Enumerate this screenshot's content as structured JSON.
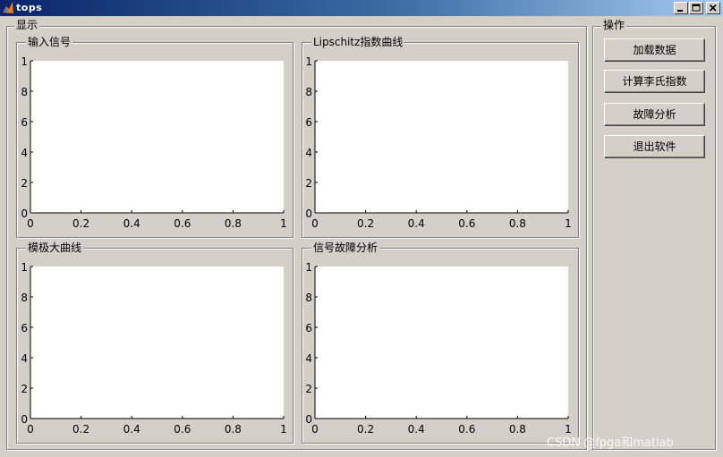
{
  "window": {
    "title": "tops",
    "controls": {
      "minimize": "_",
      "maximize": "□",
      "close": "×"
    }
  },
  "display_panel": {
    "title": "显示"
  },
  "operations_panel": {
    "title": "操作"
  },
  "plots": [
    {
      "id": "input-signal",
      "title": "输入信号"
    },
    {
      "id": "lipschitz-curve",
      "title": "Lipschitz指数曲线"
    },
    {
      "id": "modulus-max-curve",
      "title": "模极大曲线"
    },
    {
      "id": "signal-fault-analysis",
      "title": "信号故障分析"
    }
  ],
  "axes_ticks": {
    "x": [
      "0",
      "0.2",
      "0.4",
      "0.6",
      "0.8",
      "1"
    ],
    "y": [
      "0",
      "2",
      "4",
      "6",
      "8",
      "1"
    ]
  },
  "buttons": [
    {
      "id": "load-data",
      "label": "加载数据"
    },
    {
      "id": "compute-lipschitz",
      "label": "计算李氏指数"
    },
    {
      "id": "fault-analysis",
      "label": "故障分析"
    },
    {
      "id": "exit",
      "label": "退出软件"
    }
  ],
  "watermark": "CSDN @fpga和matlab",
  "colors": {
    "titlebar_start": "#0a246a",
    "titlebar_end": "#a6caf0",
    "face": "#d4d0c8"
  }
}
